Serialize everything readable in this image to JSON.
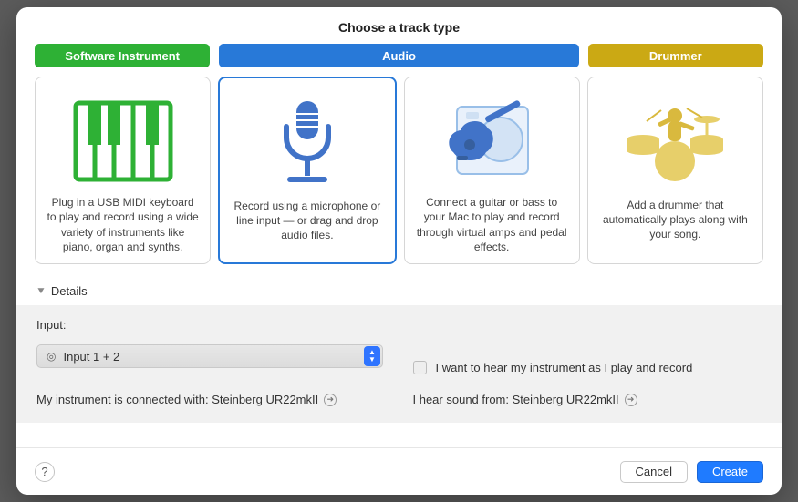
{
  "title": "Choose a track type",
  "tabs": {
    "software": "Software Instrument",
    "audio": "Audio",
    "drummer": "Drummer"
  },
  "cards": {
    "software": "Plug in a USB MIDI keyboard to play and record using a wide variety of instruments like piano, organ and synths.",
    "mic": "Record using a microphone or line input — or drag and drop audio files.",
    "guitar": "Connect a guitar or bass to your Mac to play and record through virtual amps and pedal effects.",
    "drummer": "Add a drummer that automatically plays along with your song."
  },
  "details_label": "Details",
  "input": {
    "label": "Input:",
    "value": "Input 1 + 2"
  },
  "monitor_checkbox": "I want to hear my instrument as I play and record",
  "status": {
    "connected": "My instrument is connected with: Steinberg UR22mkII",
    "hear": "I hear sound from: Steinberg UR22mkII"
  },
  "buttons": {
    "cancel": "Cancel",
    "create": "Create"
  }
}
